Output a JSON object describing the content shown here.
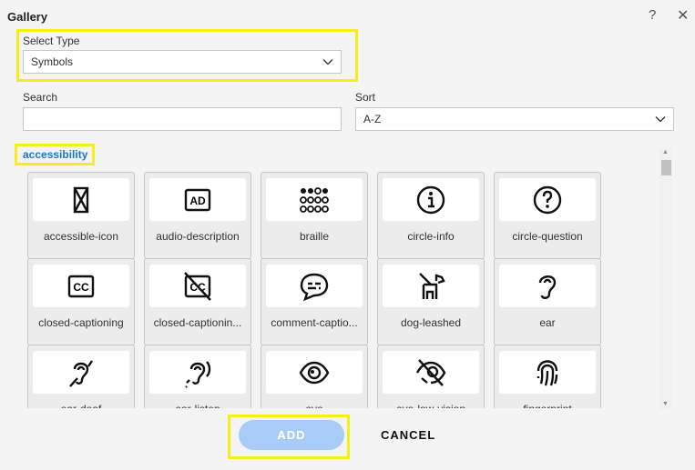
{
  "dialog": {
    "title": "Gallery",
    "help_icon": "question-mark-icon",
    "close_icon": "close-icon"
  },
  "select_type": {
    "label": "Select Type",
    "value": "Symbols"
  },
  "search": {
    "label": "Search",
    "value": "",
    "placeholder": ""
  },
  "sort": {
    "label": "Sort",
    "value": "A-Z"
  },
  "category": "accessibility",
  "items": [
    {
      "label": "accessible-icon",
      "icon": "accessible-icon"
    },
    {
      "label": "audio-description",
      "icon": "audio-description"
    },
    {
      "label": "braille",
      "icon": "braille"
    },
    {
      "label": "circle-info",
      "icon": "circle-info"
    },
    {
      "label": "circle-question",
      "icon": "circle-question"
    },
    {
      "label": "closed-captioning",
      "icon": "closed-captioning"
    },
    {
      "label": "closed-captionin...",
      "icon": "closed-captioning-slash"
    },
    {
      "label": "comment-captio...",
      "icon": "comment-captions"
    },
    {
      "label": "dog-leashed",
      "icon": "dog-leashed"
    },
    {
      "label": "ear",
      "icon": "ear"
    },
    {
      "label": "ear-deaf",
      "icon": "ear-deaf"
    },
    {
      "label": "ear-listen",
      "icon": "ear-listen"
    },
    {
      "label": "eye",
      "icon": "eye"
    },
    {
      "label": "eye-low-vision",
      "icon": "eye-low-vision"
    },
    {
      "label": "fingerprint",
      "icon": "fingerprint"
    }
  ],
  "buttons": {
    "add": "ADD",
    "cancel": "CANCEL"
  },
  "colors": {
    "accent": "#1a78c8",
    "add_button": "#a9ccf7",
    "highlight": "#f5ee1a"
  }
}
